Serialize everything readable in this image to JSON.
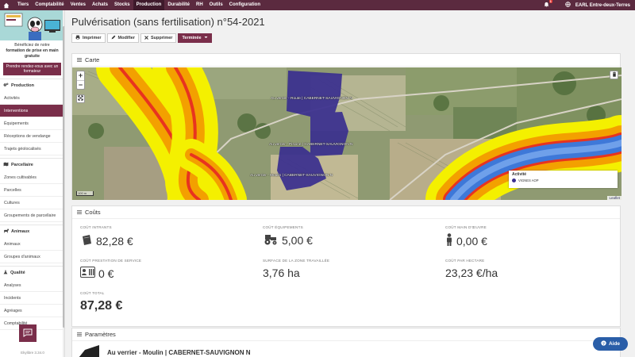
{
  "topnav": {
    "home_icon": "home-icon",
    "items": [
      {
        "label": "Tiers",
        "active": false
      },
      {
        "label": "Comptabilité",
        "active": false
      },
      {
        "label": "Ventes",
        "active": false
      },
      {
        "label": "Achats",
        "active": false
      },
      {
        "label": "Stocks",
        "active": false
      },
      {
        "label": "Production",
        "active": true
      },
      {
        "label": "Durabilité",
        "active": false
      },
      {
        "label": "RH",
        "active": false
      },
      {
        "label": "Outils",
        "active": false
      },
      {
        "label": "Configuration",
        "active": false
      }
    ],
    "notification_count": "1",
    "farm": "EARL Entre-deux-Terres"
  },
  "sidebar": {
    "promo_line1": "Bénéficiez de notre",
    "promo_bold": "formation de prise en main gratuite",
    "promo_button": "Prendre rendez-vous avec un formateur",
    "sections": [
      {
        "title": "Production",
        "icon": "gears-icon",
        "items": [
          "Activités",
          "Interventions",
          "Équipements",
          "Réceptions de vendange",
          "Trajets géolocalisés"
        ]
      },
      {
        "title": "Parcellaire",
        "icon": "map-icon",
        "items": [
          "Zones cultivables",
          "Parcelles",
          "Cultures",
          "Groupements de parcellaire"
        ]
      },
      {
        "title": "Animaux",
        "icon": "cow-icon",
        "items": [
          "Animaux",
          "Groupes d'animaux"
        ]
      },
      {
        "title": "Qualité",
        "icon": "flask-icon",
        "items": [
          "Analyses",
          "Incidents",
          "Agréages",
          "Comptabilité"
        ]
      }
    ],
    "active_item": "Interventions",
    "version": "Ekylibre 3.34.0"
  },
  "page": {
    "title": "Pulvérisation (sans fertilisation) n°54-2021",
    "buttons": {
      "print": "Imprimer",
      "edit": "Modifier",
      "delete": "Supprimer",
      "status": "Terminée"
    }
  },
  "map_panel": {
    "title": "Carte",
    "zoom_in": "+",
    "zoom_out": "−",
    "labels": [
      "Au verrier - Route | CABERNET-SAUVIGNON N",
      "Au verrier - Piscine | CABERNET-SAUVIGNON N",
      "Au verrier - Moulin | CABERNET-SAUVIGNON N"
    ],
    "legend_title": "Activité",
    "legend_item": "VIGNES AOP",
    "legend_color": "#3a2f8f",
    "scale": "100 m",
    "attribution": "Leaflet"
  },
  "costs_panel": {
    "title": "Coûts",
    "items": [
      {
        "label": "Coût intrants",
        "value": "82,28 €",
        "icon": "bag-icon"
      },
      {
        "label": "Coût équipements",
        "value": "5,00 €",
        "icon": "tractor-icon"
      },
      {
        "label": "Coût main d'œuvre",
        "value": "0,00 €",
        "icon": "person-icon"
      },
      {
        "label": "Coût prestation de service",
        "value": "0 €",
        "icon": "id-card-icon"
      },
      {
        "label": "Surface de la zone travaillée",
        "value": "3,76 ha",
        "icon": ""
      },
      {
        "label": "Coût par hectare",
        "value": "23,23 €/ha",
        "icon": ""
      },
      {
        "label": "Coût total",
        "value": "87,28 €",
        "icon": ""
      }
    ]
  },
  "params_panel": {
    "title": "Paramètres",
    "first_param": "Au verrier - Moulin | CABERNET-SAUVIGNON N"
  },
  "help_button": "Aide"
}
